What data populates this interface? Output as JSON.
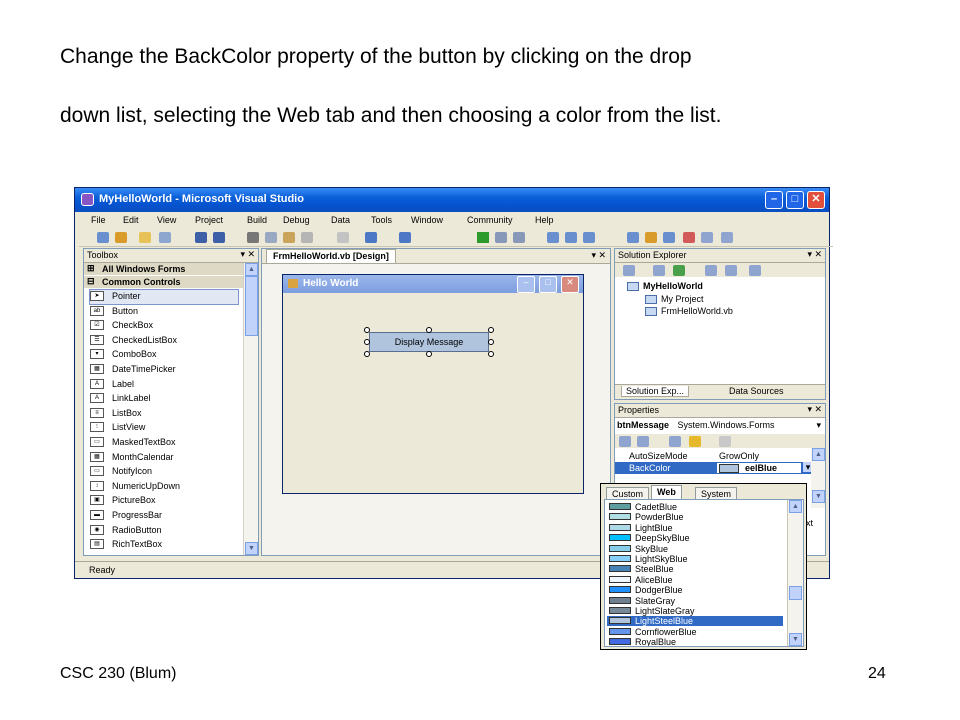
{
  "slide": {
    "caption_line1": "Change the BackColor property of the button by clicking on the drop",
    "caption_line2": "down list, selecting the Web tab and then choosing a color from the list.",
    "footer_left": "CSC 230 (Blum)",
    "page_number": "24"
  },
  "window": {
    "title": "MyHelloWorld - Microsoft Visual Studio",
    "menu": [
      "File",
      "Edit",
      "View",
      "Project",
      "Build",
      "Debug",
      "Data",
      "Tools",
      "Window",
      "Community",
      "Help"
    ]
  },
  "toolbox": {
    "header": "Toolbox",
    "header_controls": "▾ ✕",
    "group_all": "All Windows Forms",
    "group_common": "Common Controls",
    "items": [
      "Pointer",
      "Button",
      "CheckBox",
      "CheckedListBox",
      "ComboBox",
      "DateTimePicker",
      "Label",
      "LinkLabel",
      "ListBox",
      "ListView",
      "MaskedTextBox",
      "MonthCalendar",
      "NotifyIcon",
      "NumericUpDown",
      "PictureBox",
      "ProgressBar",
      "RadioButton",
      "RichTextBox"
    ]
  },
  "designer": {
    "tab": "FrmHelloWorld.vb [Design]",
    "tab_controls": "▾ ✕",
    "form_title": "Hello World",
    "button_text": "Display Message"
  },
  "solution_explorer": {
    "header": "Solution Explorer",
    "header_controls": "▾ ✕",
    "solution": "MyHelloWorld",
    "project": "My Project",
    "file": "FrmHelloWorld.vb",
    "tab1": "Solution Exp...",
    "tab2": "Data Sources"
  },
  "properties": {
    "header": "Properties",
    "header_controls": "▾ ✕",
    "object": "btnMessage",
    "object_type": "System.Windows.Forms",
    "rows": [
      {
        "name": "AutoSizeMode",
        "value": "GrowOnly"
      },
      {
        "name": "BackColor",
        "value": "eelBlue"
      }
    ],
    "partial_text": "ext"
  },
  "status": {
    "text": "Ready"
  },
  "color_dropdown": {
    "tabs": [
      "Custom",
      "Web",
      "System"
    ],
    "active_tab": "Web",
    "selected": "LightSteelBlue",
    "colors": [
      {
        "name": "CadetBlue",
        "hex": "#5f9ea0"
      },
      {
        "name": "PowderBlue",
        "hex": "#b0e0e6"
      },
      {
        "name": "LightBlue",
        "hex": "#add8e6"
      },
      {
        "name": "DeepSkyBlue",
        "hex": "#00bfff"
      },
      {
        "name": "SkyBlue",
        "hex": "#87ceeb"
      },
      {
        "name": "LightSkyBlue",
        "hex": "#87cefa"
      },
      {
        "name": "SteelBlue",
        "hex": "#4682b4"
      },
      {
        "name": "AliceBlue",
        "hex": "#f0f8ff"
      },
      {
        "name": "DodgerBlue",
        "hex": "#1e90ff"
      },
      {
        "name": "SlateGray",
        "hex": "#708090"
      },
      {
        "name": "LightSlateGray",
        "hex": "#778899"
      },
      {
        "name": "LightSteelBlue",
        "hex": "#b0c4de"
      },
      {
        "name": "CornflowerBlue",
        "hex": "#6495ed"
      },
      {
        "name": "RoyalBlue",
        "hex": "#4169e1"
      }
    ]
  }
}
